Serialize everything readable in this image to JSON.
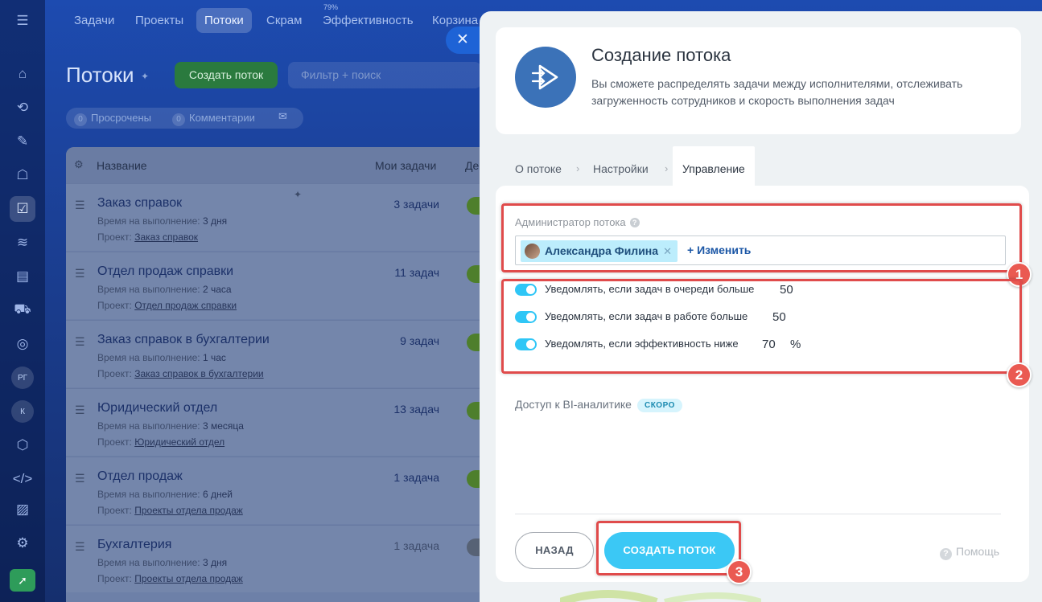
{
  "topnav": {
    "tabs": [
      "Задачи",
      "Проекты",
      "Потоки",
      "Скрам",
      "Эффективность",
      "Корзина"
    ],
    "efficiency_sup": "79%"
  },
  "page": {
    "title": "Потоки",
    "create_button": "Создать поток",
    "filter_placeholder": "Фильтр + поиск",
    "counters": [
      {
        "num": "0",
        "label": "Просрочены"
      },
      {
        "num": "0",
        "label": "Комментарии"
      }
    ]
  },
  "left_rail": {
    "badges": [
      "РГ",
      "К"
    ]
  },
  "grid": {
    "columns": [
      "Название",
      "Мои задачи",
      "Де"
    ],
    "rows": [
      {
        "title": "Заказ справок",
        "time_label": "Время на выполнение:",
        "time": "3 дня",
        "project_label": "Проект:",
        "project": "Заказ справок",
        "count": "3 задачи"
      },
      {
        "title": "Отдел продаж справки",
        "time_label": "Время на выполнение:",
        "time": "2 часа",
        "project_label": "Проект:",
        "project": "Отдел продаж справки",
        "count": "11 задач"
      },
      {
        "title": "Заказ справок в бухгалтерии",
        "time_label": "Время на выполнение:",
        "time": "1 час",
        "project_label": "Проект:",
        "project": "Заказ справок в бухгалтерии",
        "count": "9 задач"
      },
      {
        "title": "Юридический отдел",
        "time_label": "Время на выполнение:",
        "time": "3 месяца",
        "project_label": "Проект:",
        "project": "Юридический отдел",
        "count": "13 задач"
      },
      {
        "title": "Отдел продаж",
        "time_label": "Время на выполнение:",
        "time": "6 дней",
        "project_label": "Проект:",
        "project": "Проекты отдела продаж",
        "count": "1 задача"
      },
      {
        "title": "Бухгалтерия",
        "time_label": "Время на выполнение:",
        "time": "3 дня",
        "project_label": "Проект:",
        "project": "Проекты отдела продаж",
        "count": "1 задача"
      }
    ]
  },
  "slider": {
    "header": {
      "title": "Создание потока",
      "description": "Вы сможете распределять задачи между исполнителями, отслеживать загруженность сотрудников и скорость выполнения задач"
    },
    "steps": [
      "О потоке",
      "Настройки",
      "Управление"
    ],
    "admin": {
      "label": "Администратор потока",
      "user": "Александра Филина",
      "change_link": "+ Изменить"
    },
    "notifications": [
      {
        "label": "Уведомлять, если задач в очереди больше",
        "value": "50",
        "unit": ""
      },
      {
        "label": "Уведомлять, если задач в работе больше",
        "value": "50",
        "unit": ""
      },
      {
        "label": "Уведомлять, если эффективность ниже",
        "value": "70",
        "unit": "%"
      }
    ],
    "bi": {
      "label": "Доступ к BI-аналитике",
      "badge": "СКОРО"
    },
    "buttons": {
      "back": "НАЗАД",
      "create": "СОЗДАТЬ ПОТОК",
      "help": "Помощь"
    }
  },
  "annotations": [
    "1",
    "2",
    "3"
  ],
  "colors": {
    "accent": "#3bc8f5",
    "highlight": "#e04b4b",
    "badge": "#ea5a52"
  }
}
